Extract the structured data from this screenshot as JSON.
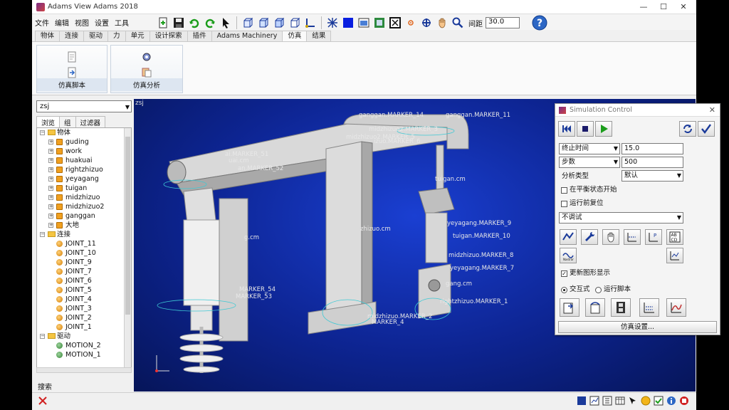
{
  "window": {
    "title": "Adams View Adams 2018",
    "minimize": "—",
    "maximize": "☐",
    "close": "✕"
  },
  "menu": [
    "文件",
    "编辑",
    "视图",
    "设置",
    "工具"
  ],
  "toolbar": {
    "spacing_label": "间距",
    "spacing_value": "30.0",
    "help": "?"
  },
  "tabs": [
    {
      "label": "物体",
      "active": false
    },
    {
      "label": "连接",
      "active": false
    },
    {
      "label": "驱动",
      "active": false
    },
    {
      "label": "力",
      "active": false
    },
    {
      "label": "单元",
      "active": false
    },
    {
      "label": "设计探索",
      "active": false
    },
    {
      "label": "插件",
      "active": false
    },
    {
      "label": "Adams Machinery",
      "active": false
    },
    {
      "label": "仿真",
      "active": true
    },
    {
      "label": "结果",
      "active": false
    }
  ],
  "ribbon": {
    "script_label": "仿真脚本",
    "analysis_label": "仿真分析"
  },
  "browser": {
    "model": "zsj",
    "subtabs": [
      "浏览",
      "组",
      "过滤器"
    ],
    "tree": [
      {
        "level": 0,
        "kind": "folder",
        "label": "物体",
        "exp": "−"
      },
      {
        "level": 1,
        "kind": "part",
        "label": "guding",
        "exp": "+"
      },
      {
        "level": 1,
        "kind": "part",
        "label": "work",
        "exp": "+"
      },
      {
        "level": 1,
        "kind": "part",
        "label": "huakuai",
        "exp": "+"
      },
      {
        "level": 1,
        "kind": "part",
        "label": "rightzhizuo",
        "exp": "+"
      },
      {
        "level": 1,
        "kind": "part",
        "label": "yeyagang",
        "exp": "+"
      },
      {
        "level": 1,
        "kind": "part",
        "label": "tuigan",
        "exp": "+"
      },
      {
        "level": 1,
        "kind": "part",
        "label": "midzhizuo",
        "exp": "+"
      },
      {
        "level": 1,
        "kind": "part",
        "label": "midzhizuo2",
        "exp": "+"
      },
      {
        "level": 1,
        "kind": "part",
        "label": "ganggan",
        "exp": "+"
      },
      {
        "level": 1,
        "kind": "part",
        "label": "大地",
        "exp": "+"
      },
      {
        "level": 0,
        "kind": "folder",
        "label": "连接",
        "exp": "−"
      },
      {
        "level": 1,
        "kind": "joint",
        "label": "JOINT_11",
        "exp": ""
      },
      {
        "level": 1,
        "kind": "joint",
        "label": "JOINT_10",
        "exp": ""
      },
      {
        "level": 1,
        "kind": "joint",
        "label": "JOINT_9",
        "exp": ""
      },
      {
        "level": 1,
        "kind": "joint",
        "label": "JOINT_7",
        "exp": ""
      },
      {
        "level": 1,
        "kind": "joint",
        "label": "JOINT_6",
        "exp": ""
      },
      {
        "level": 1,
        "kind": "joint",
        "label": "JOINT_5",
        "exp": ""
      },
      {
        "level": 1,
        "kind": "joint",
        "label": "JOINT_4",
        "exp": ""
      },
      {
        "level": 1,
        "kind": "joint",
        "label": "JOINT_3",
        "exp": ""
      },
      {
        "level": 1,
        "kind": "joint",
        "label": "JOINT_2",
        "exp": ""
      },
      {
        "level": 1,
        "kind": "joint",
        "label": "JOINT_1",
        "exp": ""
      },
      {
        "level": 0,
        "kind": "folder",
        "label": "驱动",
        "exp": "−"
      },
      {
        "level": 1,
        "kind": "motion",
        "label": "MOTION_2",
        "exp": ""
      },
      {
        "level": 1,
        "kind": "motion",
        "label": "MOTION_1",
        "exp": ""
      }
    ],
    "search_label": "搜索"
  },
  "viewport": {
    "model_label": "zsj",
    "labels": [
      {
        "text": "ganggan.MARKER_14"
      },
      {
        "text": "ganggan.MARKER_11"
      },
      {
        "text": "midzhizuo2.MARKER_3"
      },
      {
        "text": "midzhizuo2.MARKER_5"
      },
      {
        "text": "izuo.MARKER_6"
      },
      {
        "text": "ai.MARKER_51"
      },
      {
        "text": "uai.cm"
      },
      {
        "text": "an.MARKER_52"
      },
      {
        "text": "tuigan.cm"
      },
      {
        "text": "zhizuo.cm"
      },
      {
        "text": "yeyagang.MARKER_9"
      },
      {
        "text": "tuigan.MARKER_10"
      },
      {
        "text": "midzhizuo.MARKER_8"
      },
      {
        "text": "yeyagang.MARKER_7"
      },
      {
        "text": "g.cm"
      },
      {
        "text": "MARKER_54"
      },
      {
        "text": "MARKER_53"
      },
      {
        "text": "gang.cm"
      },
      {
        "text": "rightzhizuo.MARKER_1"
      },
      {
        "text": "midzhizuo.MARKER_2"
      },
      {
        "text": "MARKER_4"
      }
    ]
  },
  "simulation_control": {
    "title": "Simulation Control",
    "end_mode": "终止时间",
    "end_value": "15.0",
    "steps_mode": "步数",
    "steps_value": "500",
    "analysis_type_label": "分析类型",
    "analysis_type": "默认",
    "start_static_label": "在平衡状态开始",
    "reset_label": "运行前复位",
    "debug_mode": "不调试",
    "update_graphics_label": "更新图形显示",
    "update_graphics_checked": true,
    "interactive_label": "交互式",
    "script_mode_label": "运行脚本",
    "settings_button": "仿真设置..."
  },
  "colors": {
    "accent": "#0a37c8",
    "viewport_bg": "#0d2491",
    "play_green": "#1b9d1b"
  }
}
